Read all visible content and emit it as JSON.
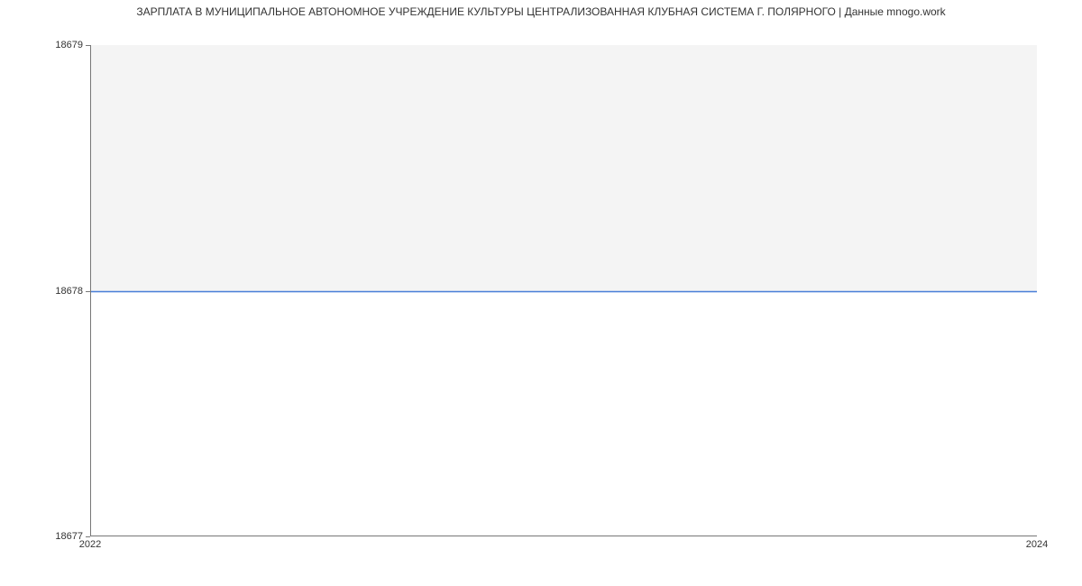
{
  "chart_data": {
    "type": "line",
    "title": "ЗАРПЛАТА В МУНИЦИПАЛЬНОЕ АВТОНОМНОЕ УЧРЕЖДЕНИЕ КУЛЬТУРЫ ЦЕНТРАЛИЗОВАННАЯ КЛУБНАЯ СИСТЕМА Г. ПОЛЯРНОГО | Данные mnogo.work",
    "x": [
      2022,
      2024
    ],
    "series": [
      {
        "name": "salary",
        "values": [
          18678,
          18678
        ]
      }
    ],
    "xlabel": "",
    "ylabel": "",
    "xlim": [
      2022,
      2024
    ],
    "ylim": [
      18677,
      18679
    ],
    "y_ticks": [
      18677,
      18678,
      18679
    ],
    "x_ticks": [
      2022,
      2024
    ]
  }
}
